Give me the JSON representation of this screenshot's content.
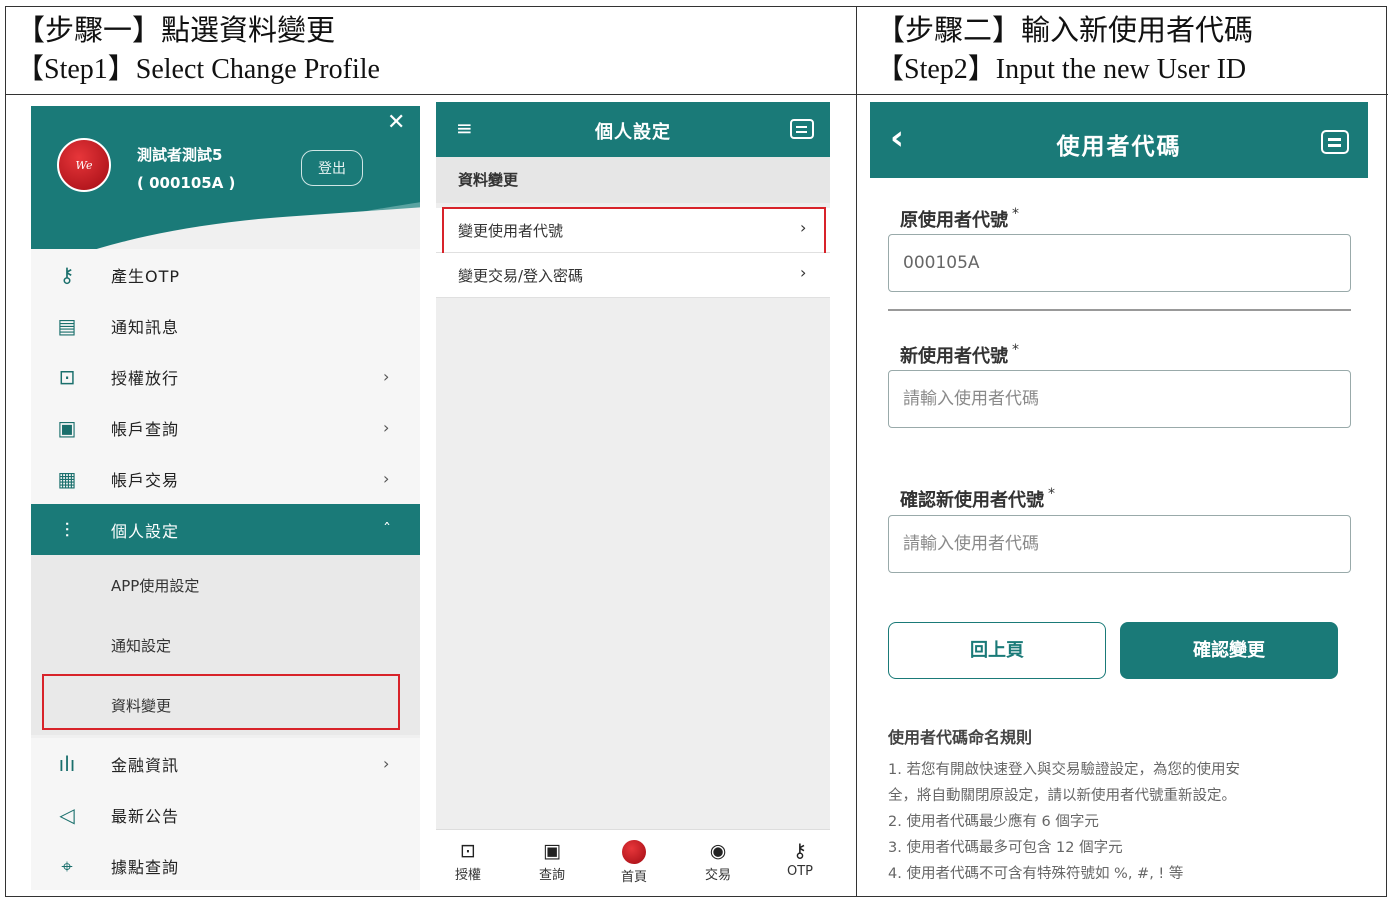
{
  "doc": {
    "step1_zh": "【步驟一】點選資料變更",
    "step1_en": "【Step1】Select Change Profile",
    "step2_zh": "【步驟二】輸入新使用者代碼",
    "step2_en": "【Step2】Input the new User ID"
  },
  "drawer": {
    "user_name": "測試者測試5",
    "user_id": "( 000105A )",
    "logout_label": "登出",
    "close_icon": "close-icon",
    "items": [
      {
        "label": "產生OTP",
        "icon": "key-icon"
      },
      {
        "label": "通知訊息",
        "icon": "message-icon"
      },
      {
        "label": "授權放行",
        "icon": "authorize-icon",
        "chevron": "›"
      },
      {
        "label": "帳戶查詢",
        "icon": "account-search-icon",
        "chevron": "›"
      },
      {
        "label": "帳戶交易",
        "icon": "account-transaction-icon",
        "chevron": "›"
      },
      {
        "label": "個人設定",
        "icon": "settings-sliders-icon",
        "chevron": "ˆ"
      }
    ],
    "sub_items": [
      "APP使用設定",
      "通知設定",
      "資料變更"
    ],
    "bottom_items": [
      {
        "label": "金融資訊",
        "icon": "chart-icon",
        "chevron": "›"
      },
      {
        "label": "最新公告",
        "icon": "megaphone-icon"
      },
      {
        "label": "據點查詢",
        "icon": "location-icon"
      }
    ]
  },
  "settings": {
    "menu_icon": "≡",
    "title": "個人設定",
    "section": "資料變更",
    "rows": [
      {
        "label": "變更使用者代號",
        "chevron": "›"
      },
      {
        "label": "變更交易/登入密碼",
        "chevron": "›"
      }
    ],
    "tabs": [
      "授權",
      "查詢",
      "首頁",
      "交易",
      "OTP"
    ]
  },
  "userid_form": {
    "back_icon": "‹",
    "title": "使用者代碼",
    "original_label": "原使用者代號",
    "original_value": "000105A",
    "new_label": "新使用者代號",
    "new_placeholder": "請輸入使用者代碼",
    "confirm_label": "確認新使用者代號",
    "confirm_placeholder": "請輸入使用者代碼",
    "required_mark": "*",
    "back_button": "回上頁",
    "submit_button": "確認變更",
    "rules_title": "使用者代碼命名規則",
    "rules": [
      "1. 若您有開啟快速登入與交易驗證設定，為您的使用安",
      "全，將自動關閉原設定，請以新使用者代號重新設定。",
      "2. 使用者代碼最少應有 6 個字元",
      "3. 使用者代碼最多可包含 12 個字元",
      "4. 使用者代碼不可含有特殊符號如 %, #, ! 等"
    ]
  },
  "colors": {
    "primary": "#1a7a78",
    "highlight": "#d8232a"
  }
}
